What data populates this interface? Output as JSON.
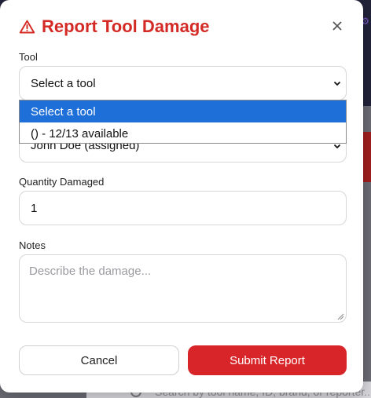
{
  "background": {
    "search_placeholder": "Search by tool name, ID, brand, or reporter..."
  },
  "modal": {
    "title": "Report Tool Damage",
    "title_icon": "warning-triangle-icon",
    "close_icon": "close-icon",
    "accent_color": "#d8252a"
  },
  "fields": {
    "tool": {
      "label": "Tool",
      "value": "Select a tool",
      "options": [
        "Select a tool",
        "() - 12/13 available"
      ]
    },
    "reporter": {
      "value": "John Doe (assigned)"
    },
    "quantity": {
      "label": "Quantity Damaged",
      "value": "1"
    },
    "notes": {
      "label": "Notes",
      "placeholder": "Describe the damage..."
    }
  },
  "buttons": {
    "cancel": "Cancel",
    "submit": "Submit Report"
  }
}
